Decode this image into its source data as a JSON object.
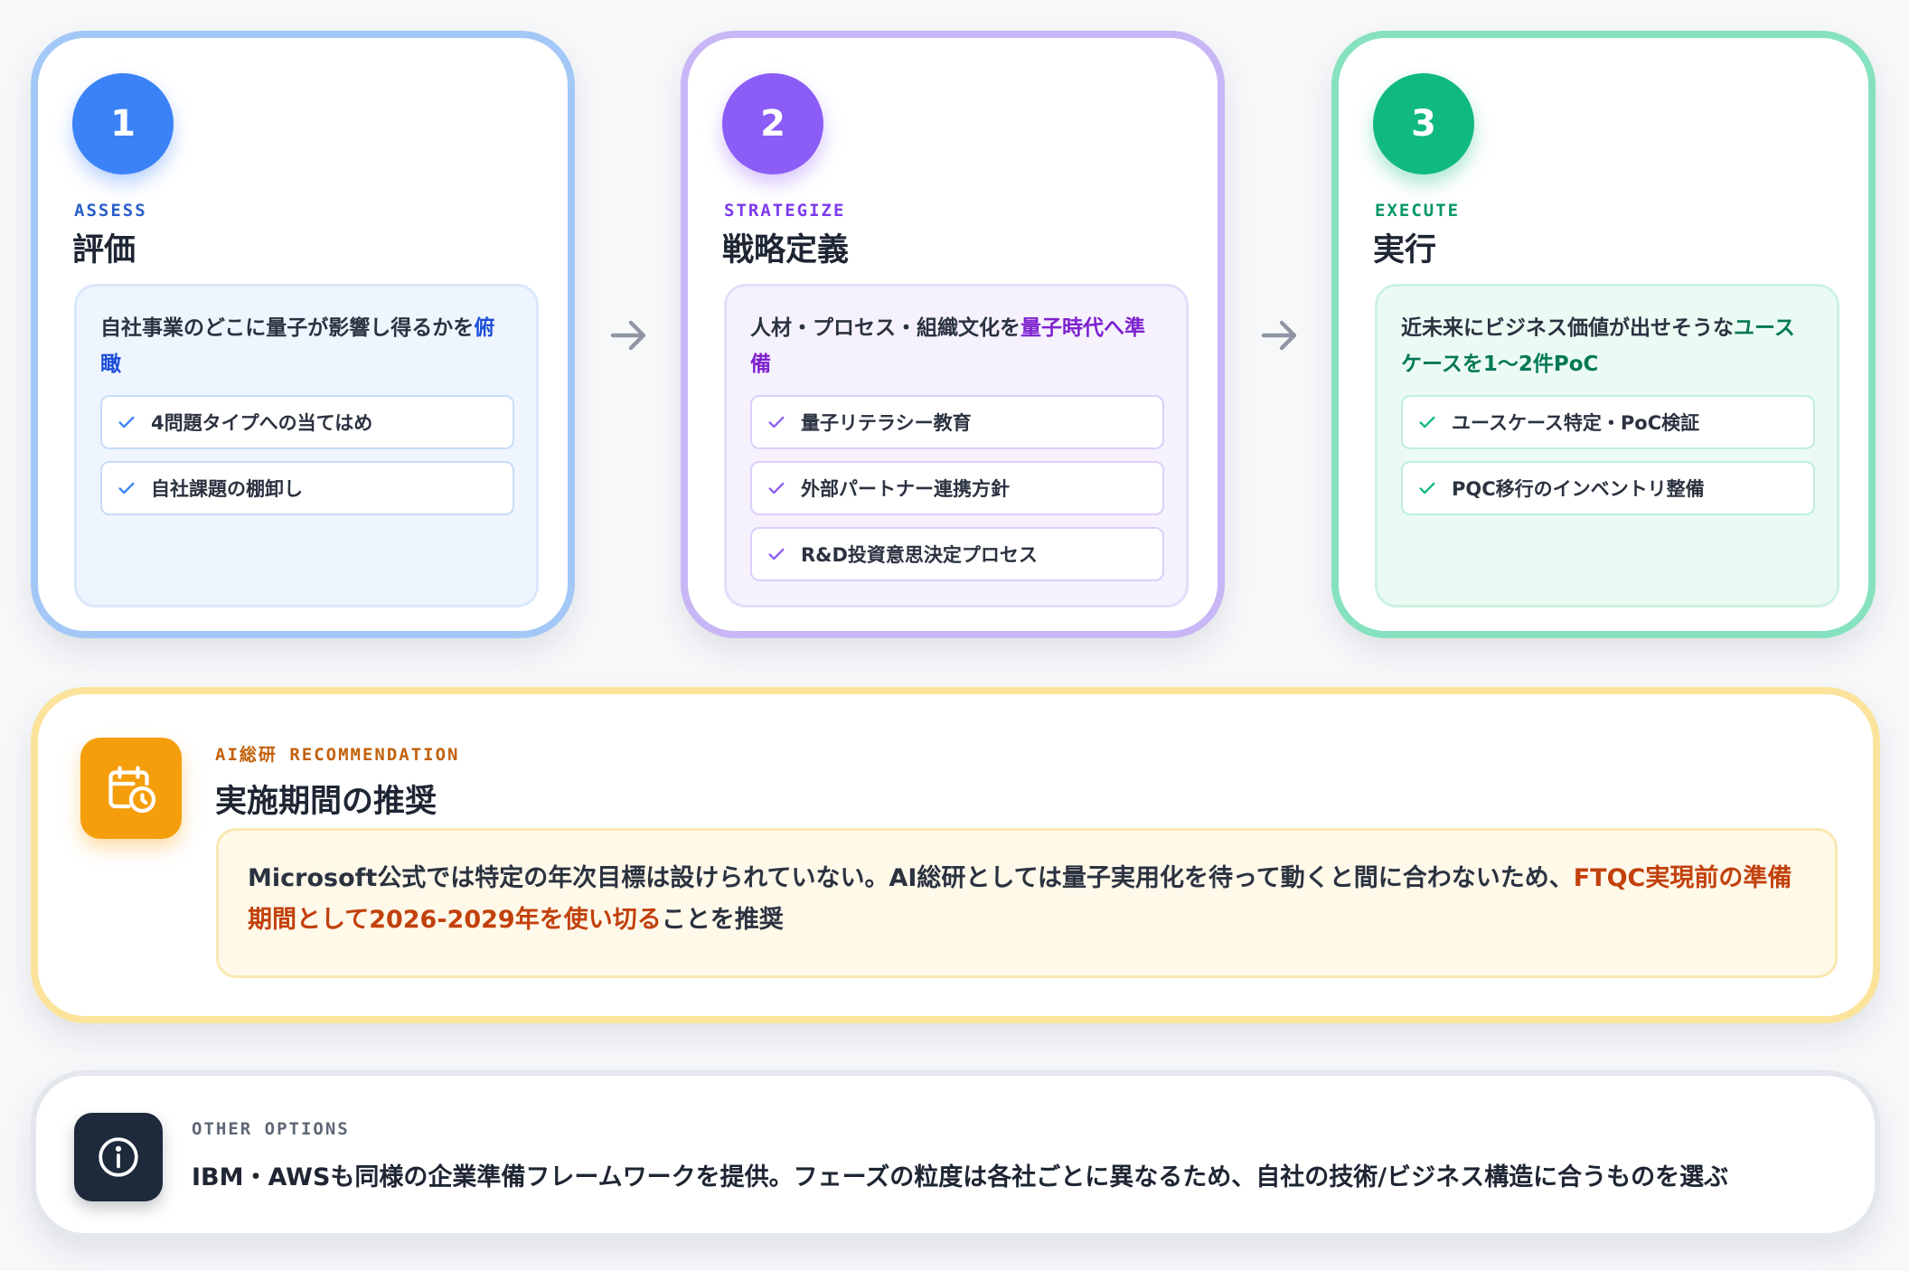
{
  "phases": [
    {
      "number": "1",
      "eng": "ASSESS",
      "title": "評価",
      "desc_pre": "自社事業のどこに量子が影響し得るかを",
      "desc_hl": "俯瞰",
      "items": [
        "4問題タイプへの当てはめ",
        "自社課題の棚卸し"
      ]
    },
    {
      "number": "2",
      "eng": "STRATEGIZE",
      "title": "戦略定義",
      "desc_pre": "人材・プロセス・組織文化を",
      "desc_hl": "量子時代へ準備",
      "items": [
        "量子リテラシー教育",
        "外部パートナー連携方針",
        "R&D投資意思決定プロセス"
      ]
    },
    {
      "number": "3",
      "eng": "EXECUTE",
      "title": "実行",
      "desc_pre": "近未来にビジネス価値が出せそうな",
      "desc_hl": "ユースケースを1〜2件PoC",
      "items": [
        "ユースケース特定・PoC検証",
        "PQC移行のインベントリ整備"
      ]
    }
  ],
  "recommendation": {
    "eng": "AI総研 RECOMMENDATION",
    "title": "実施期間の推奨",
    "text_pre": "Microsoft公式では特定の年次目標は設けられていない。AI総研としては量子実用化を待って動くと間に合わないため、",
    "text_hl": "FTQC実現前の準備期間として2026-2029年を使い切る",
    "text_post": "ことを推奨"
  },
  "other": {
    "eng": "OTHER OPTIONS",
    "text": "IBM・AWSも同様の企業準備フレームワークを提供。フェーズの粒度は各社ごとに異なるため、自社の技術/ビジネス構造に合うものを選ぶ"
  },
  "icons": {
    "check": "check-icon",
    "arrow": "arrow-right-icon",
    "recommendation": "calendar-clock-icon",
    "other": "info-icon"
  },
  "colors": {
    "assess": "#3b82f6",
    "strategize": "#8b5cf6",
    "execute": "#10b981",
    "recommendation": "#f59e0b",
    "other": "#1e293b"
  }
}
